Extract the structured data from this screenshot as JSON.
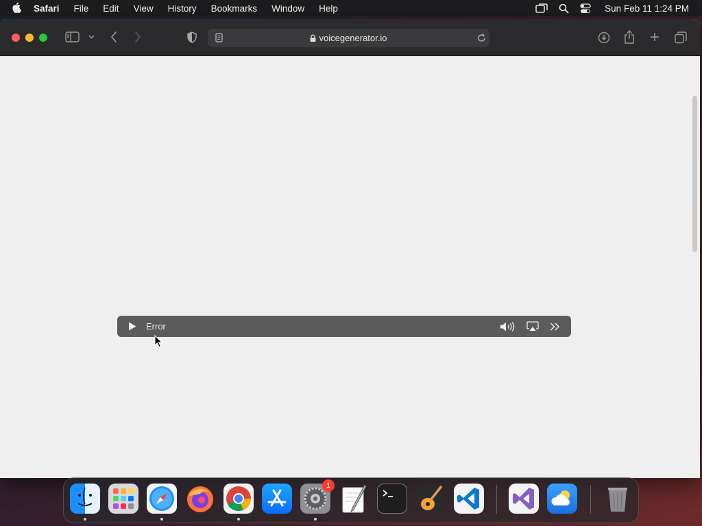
{
  "menubar": {
    "app_name": "Safari",
    "items": [
      "File",
      "Edit",
      "View",
      "History",
      "Bookmarks",
      "Window",
      "Help"
    ],
    "clock": "Sun Feb 11  1:24 PM"
  },
  "browser": {
    "url": "voicegenerator.io"
  },
  "player": {
    "status": "Error"
  },
  "dock": {
    "apps": [
      "finder",
      "launchpad",
      "safari",
      "firefox",
      "chrome",
      "app-store",
      "system-settings",
      "textedit",
      "terminal",
      "garageband",
      "vscode",
      "visual-studio",
      "weather",
      "trash"
    ],
    "system_settings_badge": "1"
  }
}
